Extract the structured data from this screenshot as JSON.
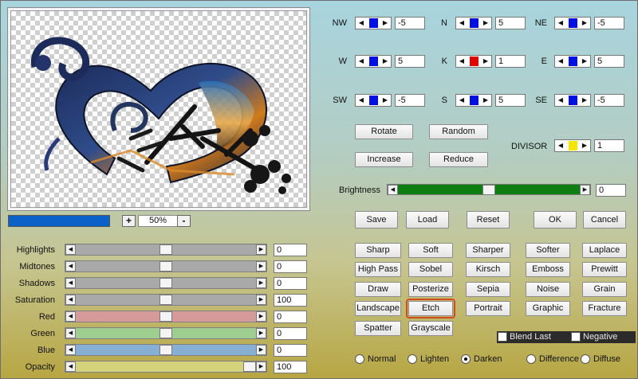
{
  "zoom": {
    "value": "50%",
    "plus": "+",
    "minus": "-"
  },
  "sliders": [
    {
      "label": "Highlights",
      "value": "0",
      "level": 0.5,
      "color": "#a9a9a9"
    },
    {
      "label": "Midtones",
      "value": "0",
      "level": 0.5,
      "color": "#a9a9a9"
    },
    {
      "label": "Shadows",
      "value": "0",
      "level": 0.5,
      "color": "#a9a9a9"
    },
    {
      "label": "Saturation",
      "value": "100",
      "level": 0.5,
      "color": "#a9a9a9"
    },
    {
      "label": "Red",
      "value": "0",
      "level": 0.5,
      "color": "#d69a9a"
    },
    {
      "label": "Green",
      "value": "0",
      "level": 0.5,
      "color": "#9ecf90"
    },
    {
      "label": "Blue",
      "value": "0",
      "level": 0.5,
      "color": "#87aed3"
    },
    {
      "label": "Opacity",
      "value": "100",
      "level": 1.0,
      "color": "#d4d27a"
    }
  ],
  "matrix": {
    "nw": {
      "label": "NW",
      "value": "-5"
    },
    "n": {
      "label": "N",
      "value": "5"
    },
    "ne": {
      "label": "NE",
      "value": "-5"
    },
    "w": {
      "label": "W",
      "value": "5"
    },
    "k": {
      "label": "K",
      "value": "1"
    },
    "e": {
      "label": "E",
      "value": "5"
    },
    "sw": {
      "label": "SW",
      "value": "-5"
    },
    "s": {
      "label": "S",
      "value": "5"
    },
    "se": {
      "label": "SE",
      "value": "-5"
    }
  },
  "divisor": {
    "label": "DIVISOR",
    "value": "1"
  },
  "brightness": {
    "label": "Brightness",
    "value": "0",
    "level": 0.5
  },
  "buttons": {
    "rotate": "Rotate",
    "random": "Random",
    "increase": "Increase",
    "reduce": "Reduce",
    "save": "Save",
    "load": "Load",
    "reset": "Reset",
    "ok": "OK",
    "cancel": "Cancel"
  },
  "presets": [
    [
      "Sharp",
      "Soft",
      "Sharper",
      "Softer",
      "Laplace"
    ],
    [
      "High Pass",
      "Sobel",
      "Kirsch",
      "Emboss",
      "Prewitt"
    ],
    [
      "Draw",
      "Posterize",
      "Sepia",
      "Noise",
      "Grain"
    ],
    [
      "Landscape",
      "Etch",
      "Portrait",
      "Graphic",
      "Fracture"
    ],
    [
      "Spatter",
      "Grayscale"
    ]
  ],
  "checkboxes": {
    "blend_last": "Blend Last",
    "negative": "Negative"
  },
  "blend_modes": [
    {
      "label": "Normal",
      "selected": false
    },
    {
      "label": "Lighten",
      "selected": false
    },
    {
      "label": "Darken",
      "selected": true
    },
    {
      "label": "Difference",
      "selected": false
    },
    {
      "label": "Diffuse",
      "selected": false
    }
  ],
  "colors": {
    "accent_blue": "#0010e0",
    "center_red": "#e00000",
    "divisor_yellow": "#f4e600",
    "brightness_green": "#0e7d12",
    "highlight": "#d24b1c"
  }
}
